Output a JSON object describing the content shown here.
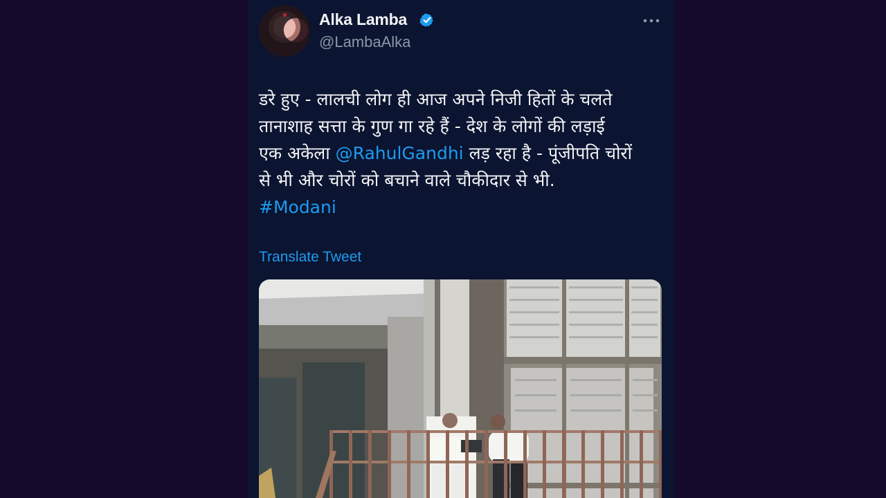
{
  "tweet": {
    "author": {
      "name": "Alka Lamba",
      "handle": "@LambaAlka",
      "verified": true,
      "avatar": "profile-avatar"
    },
    "more_icon": "ellipsis-icon",
    "text_lines": [
      {
        "text": "डरे हुए - लालची लोग ही आज अपने निजी हितों के चलते"
      },
      {
        "text": "तानाशाह सत्ता के गुण गा रहे हैं - देश के लोगों की लड़ाई"
      },
      {
        "prefix": "एक अकेला ",
        "mention": "@RahulGandhi",
        "suffix": " लड़ रहा है - पूंजीपति चोरों"
      },
      {
        "text": "से भी और चोरों को बचाने वाले चौकीदार से भी."
      }
    ],
    "hashtag": "#Modani",
    "translate": "Translate Tweet"
  },
  "colors": {
    "page_background": "#160a2c",
    "tweet_background": "#0b1430",
    "primary_text": "#f4f5f7",
    "secondary_text": "#8b98a8",
    "link": "#1d9bf0",
    "verified_badge": "#1d9bf0"
  }
}
